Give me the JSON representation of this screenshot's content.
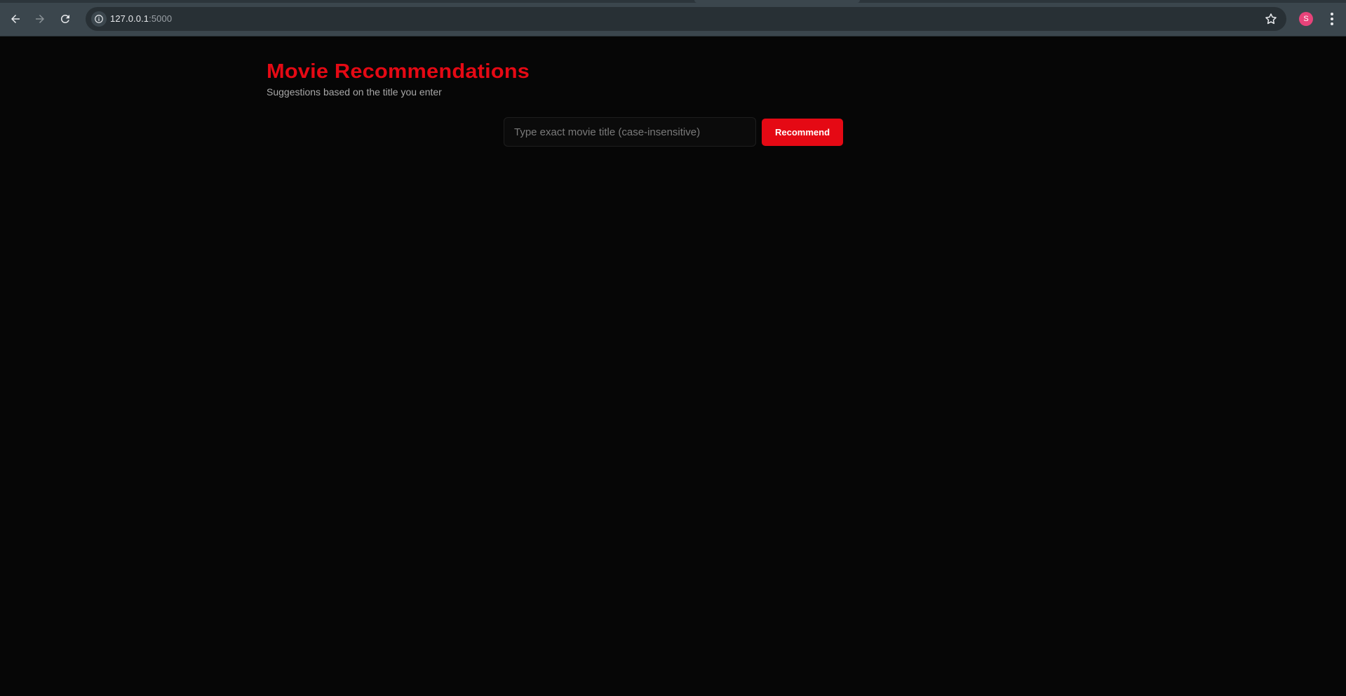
{
  "browser": {
    "url_host": "127.0.0.1",
    "url_port": ":5000",
    "profile_initial": "S",
    "profile_color": "#e8437a"
  },
  "page": {
    "title": "Movie Recommendations",
    "subtitle": "Suggestions based on the title you enter",
    "search": {
      "value": "",
      "placeholder": "Type exact movie title (case-insensitive)"
    },
    "recommend_label": "Recommend"
  },
  "colors": {
    "accent": "#e50914",
    "background": "#060606",
    "chrome": "#3b464d"
  }
}
